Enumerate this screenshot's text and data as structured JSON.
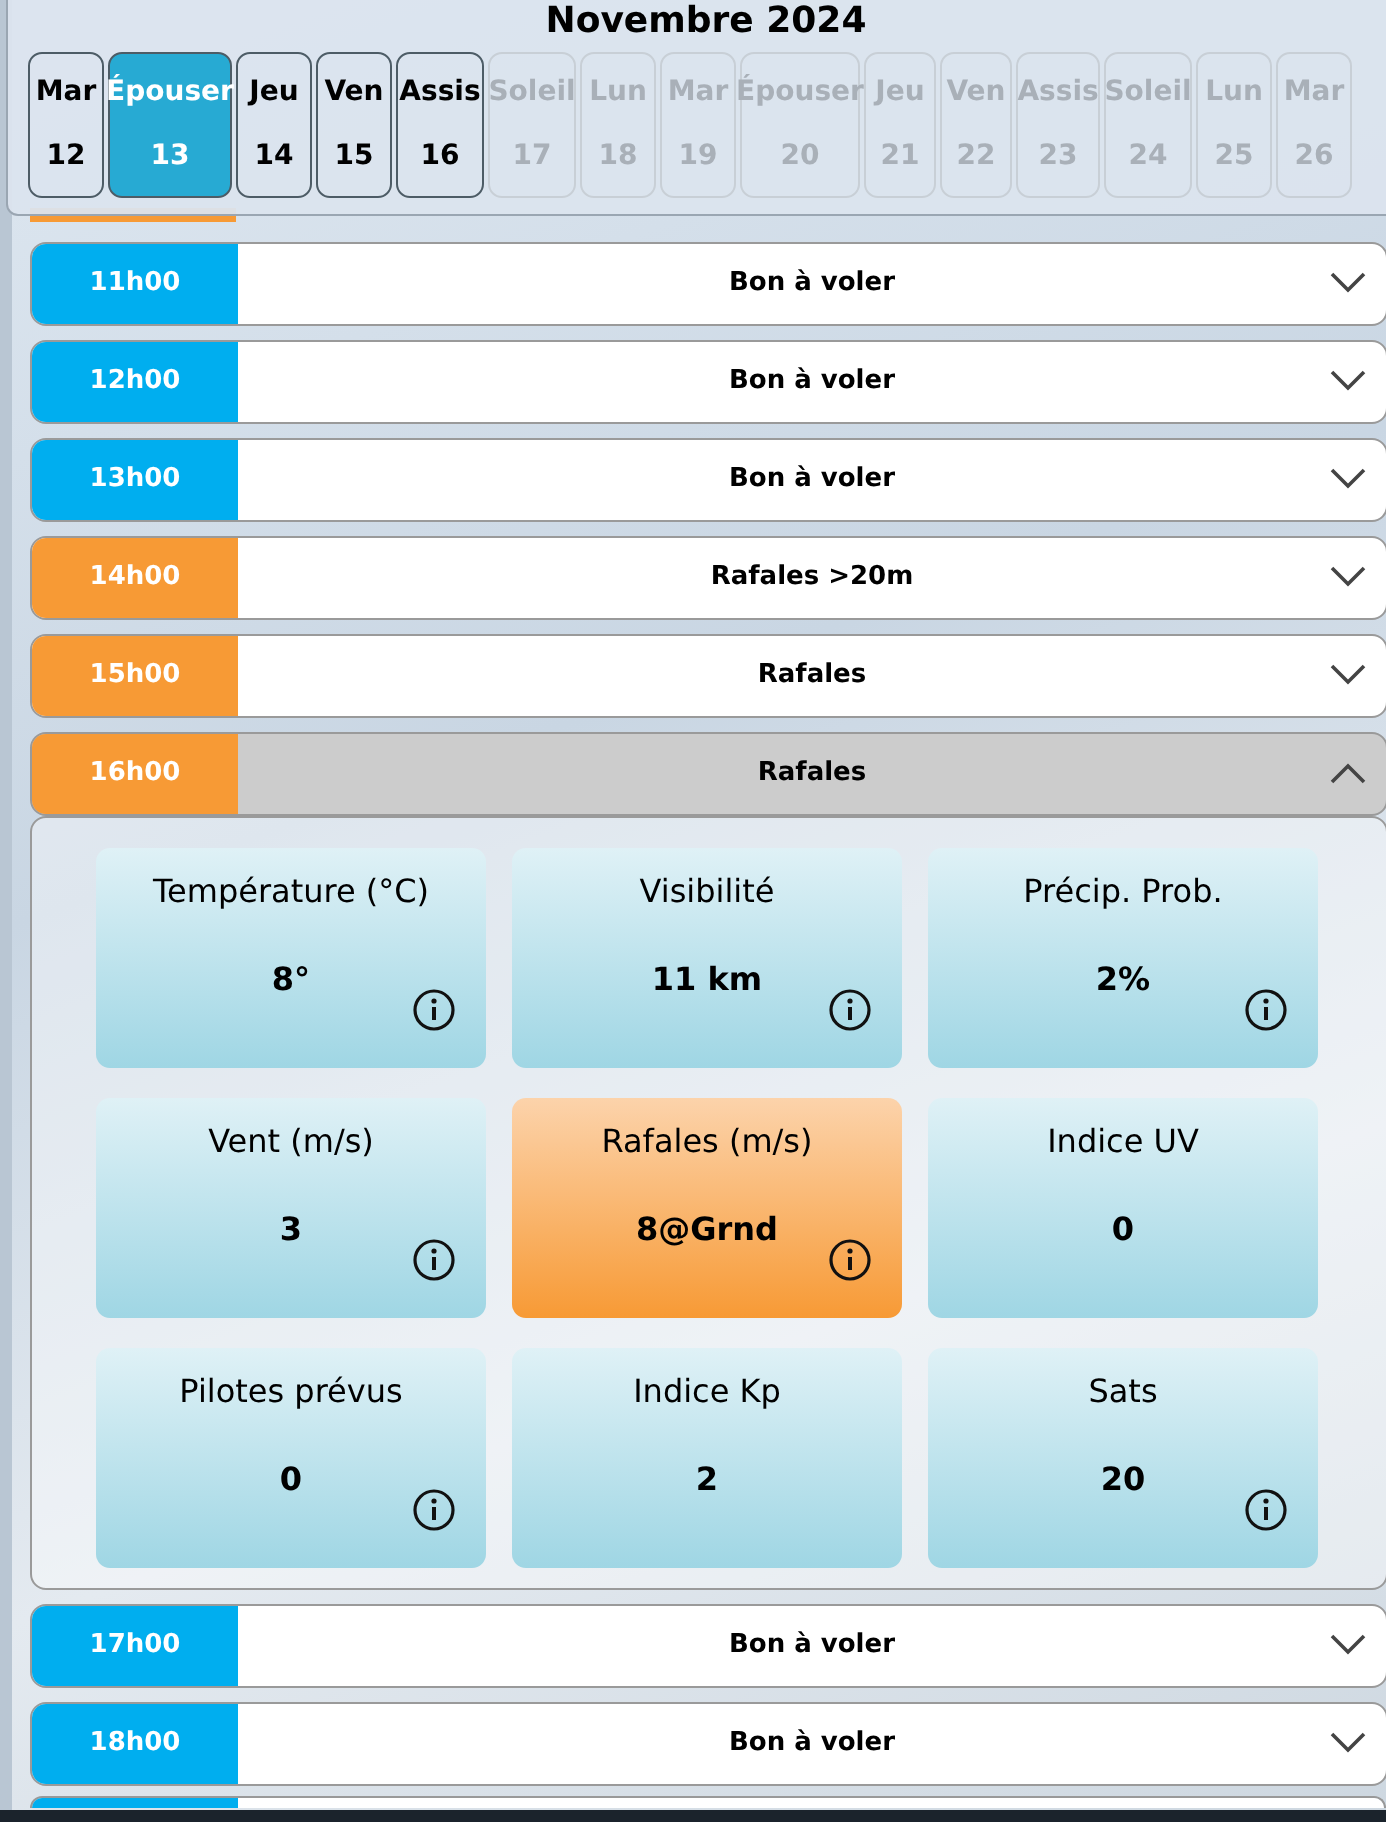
{
  "month": "Novembre 2024",
  "days": [
    {
      "name": "Mar",
      "num": "12",
      "selected": false,
      "disabled": false
    },
    {
      "name": "Épouser",
      "num": "13",
      "selected": true,
      "disabled": false
    },
    {
      "name": "Jeu",
      "num": "14",
      "selected": false,
      "disabled": false
    },
    {
      "name": "Ven",
      "num": "15",
      "selected": false,
      "disabled": false
    },
    {
      "name": "Assis",
      "num": "16",
      "selected": false,
      "disabled": false
    },
    {
      "name": "Soleil",
      "num": "17",
      "selected": false,
      "disabled": true
    },
    {
      "name": "Lun",
      "num": "18",
      "selected": false,
      "disabled": true
    },
    {
      "name": "Mar",
      "num": "19",
      "selected": false,
      "disabled": true
    },
    {
      "name": "Épouser",
      "num": "20",
      "selected": false,
      "disabled": true
    },
    {
      "name": "Jeu",
      "num": "21",
      "selected": false,
      "disabled": true
    },
    {
      "name": "Ven",
      "num": "22",
      "selected": false,
      "disabled": true
    },
    {
      "name": "Assis",
      "num": "23",
      "selected": false,
      "disabled": true
    },
    {
      "name": "Soleil",
      "num": "24",
      "selected": false,
      "disabled": true
    },
    {
      "name": "Lun",
      "num": "25",
      "selected": false,
      "disabled": true
    },
    {
      "name": "Mar",
      "num": "26",
      "selected": false,
      "disabled": true
    }
  ],
  "hours": [
    {
      "kind": "sliver_top",
      "color": "#f79a35"
    },
    {
      "kind": "row",
      "hour": "11h00",
      "label": "Bon à voler",
      "color": "#00aeef",
      "expanded": false
    },
    {
      "kind": "row",
      "hour": "12h00",
      "label": "Bon à voler",
      "color": "#00aeef",
      "expanded": false
    },
    {
      "kind": "row",
      "hour": "13h00",
      "label": "Bon à voler",
      "color": "#00aeef",
      "expanded": false
    },
    {
      "kind": "row",
      "hour": "14h00",
      "label": "Rafales >20m",
      "color": "#f79a35",
      "expanded": false
    },
    {
      "kind": "row",
      "hour": "15h00",
      "label": "Rafales",
      "color": "#f79a35",
      "expanded": false
    },
    {
      "kind": "row",
      "hour": "16h00",
      "label": "Rafales",
      "color": "#f79a35",
      "expanded": true,
      "details": [
        {
          "title": "Température (°C)",
          "value": "8°",
          "alert": false,
          "info": true
        },
        {
          "title": "Visibilité",
          "value": "11 km",
          "alert": false,
          "info": true
        },
        {
          "title": "Précip. Prob.",
          "value": "2%",
          "alert": false,
          "info": true
        },
        {
          "title": "Vent (m/s)",
          "value": "3",
          "alert": false,
          "info": true
        },
        {
          "title": "Rafales (m/s)",
          "value": "8@Grnd",
          "alert": true,
          "info": true
        },
        {
          "title": "Indice UV",
          "value": "0",
          "alert": false,
          "info": false
        },
        {
          "title": "Pilotes prévus",
          "value": "0",
          "alert": false,
          "info": true
        },
        {
          "title": "Indice Kp",
          "value": "2",
          "alert": false,
          "info": false
        },
        {
          "title": "Sats",
          "value": "20",
          "alert": false,
          "info": true
        }
      ]
    },
    {
      "kind": "row",
      "hour": "17h00",
      "label": "Bon à voler",
      "color": "#00aeef",
      "expanded": false
    },
    {
      "kind": "row",
      "hour": "18h00",
      "label": "Bon à voler",
      "color": "#00aeef",
      "expanded": false
    },
    {
      "kind": "sliver_bottom",
      "color": "#00aeef"
    }
  ]
}
